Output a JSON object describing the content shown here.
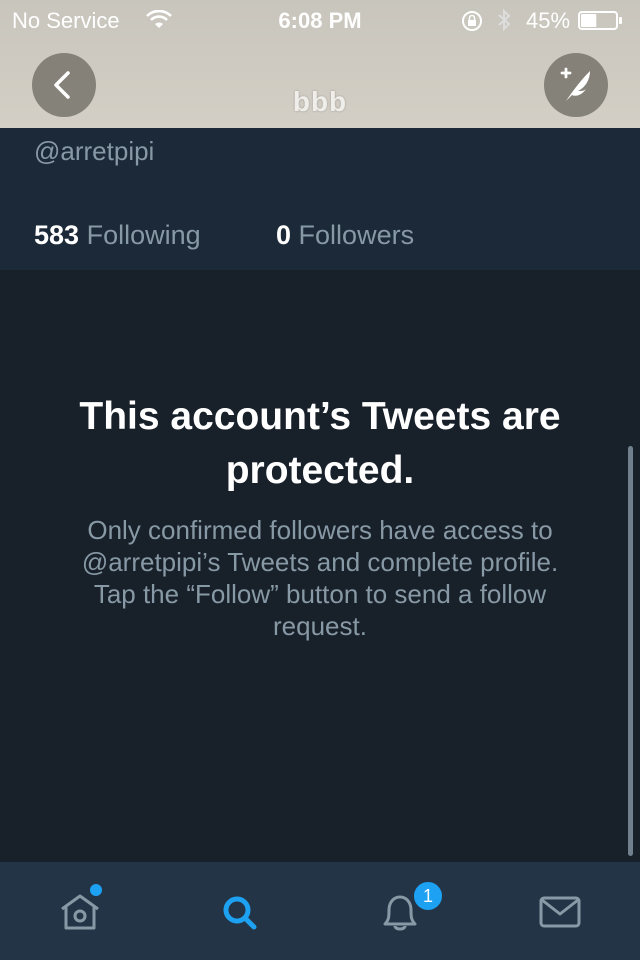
{
  "status_bar": {
    "carrier": "No Service",
    "time": "6:08 PM",
    "battery_percent": "45%",
    "battery_level": 0.45
  },
  "header": {
    "title": "bbb",
    "back_icon": "chevron-left-icon",
    "compose_icon": "compose-tweet-icon"
  },
  "profile": {
    "handle": "@arretpipi",
    "following_count": "583",
    "following_label": "Following",
    "followers_count": "0",
    "followers_label": "Followers"
  },
  "protected": {
    "title": "This account’s Tweets are protected.",
    "description": "Only confirmed followers have access to @arretpipi’s Tweets and complete profile. Tap the “Follow” button to send a follow request."
  },
  "tab_bar": {
    "tabs": [
      {
        "name": "home",
        "icon": "home-icon",
        "has_dot": true
      },
      {
        "name": "search",
        "icon": "search-icon",
        "active": true
      },
      {
        "name": "notifications",
        "icon": "bell-icon",
        "badge": "1"
      },
      {
        "name": "messages",
        "icon": "mail-icon"
      }
    ]
  },
  "colors": {
    "accent": "#1da1f2",
    "background": "#18202a",
    "profile_bg": "#1c2938",
    "tabbar_bg": "#243447",
    "muted_text": "#8899a6"
  }
}
